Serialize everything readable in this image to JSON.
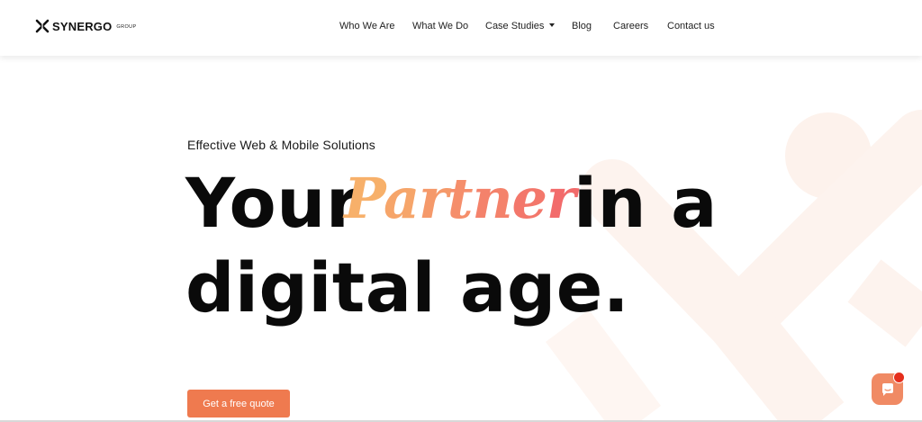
{
  "header": {
    "logo": {
      "name": "SYNERGO",
      "sub": "GROUP"
    },
    "nav": [
      {
        "label": "Who We Are"
      },
      {
        "label": "What We Do"
      },
      {
        "label": "Case Studies",
        "has_dropdown": true
      },
      {
        "label": "Blog"
      },
      {
        "label": "Careers"
      },
      {
        "label": "Contact us"
      }
    ]
  },
  "hero": {
    "kicker": "Effective Web & Mobile Solutions",
    "line1_start": "Your",
    "accent_word": "Partner",
    "line1_end": "in a",
    "line2": "digital age.",
    "cta_label": "Get a free quote"
  },
  "colors": {
    "accent": "#ef7a4f",
    "accent_gradient_start": "#f7b06a",
    "accent_gradient_end": "#f26b6b",
    "chat_button": "#f08a64",
    "notification_dot": "#e52e1c"
  },
  "icons": {
    "logo_mark": "synergo-x-logo-icon",
    "chat": "chat-bubble-icon",
    "dropdown": "caret-down-icon"
  }
}
